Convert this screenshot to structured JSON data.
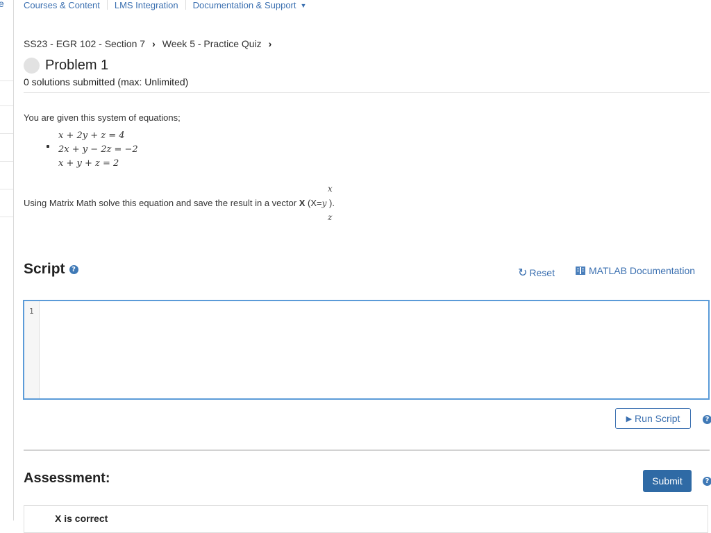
{
  "left_rail": {
    "partial_text": "e"
  },
  "topnav": {
    "items": [
      "Courses & Content",
      "LMS Integration",
      "Documentation & Support"
    ],
    "dropdown_icon": "caret-down-icon"
  },
  "breadcrumb": {
    "items": [
      "SS23 - EGR 102 - Section 7",
      "Week 5 - Practice Quiz"
    ],
    "separator_icon": "chevron-right-icon"
  },
  "problem": {
    "title": "Problem 1",
    "solutions_text": "0 solutions submitted (max: Unlimited)",
    "status_icon": "status-circle-icon"
  },
  "content": {
    "intro": "You are given this system of equations;",
    "equations": [
      "x + 2y + z = 4",
      "2x + y − 2z = −2",
      "x + y + z = 2"
    ],
    "instruction_prefix": "Using Matrix Math solve this equation and save the result in a vector ",
    "instruction_var": "X",
    "instruction_open": " (X=",
    "instruction_close": " ).",
    "vector": [
      "x",
      "y",
      "z"
    ]
  },
  "script": {
    "title": "Script",
    "reset_label": "Reset",
    "doc_label": "MATLAB Documentation",
    "line_numbers": [
      "1"
    ],
    "code": "",
    "run_label": "Run Script"
  },
  "assessment": {
    "title": "Assessment:",
    "submit_label": "Submit",
    "items": [
      "X is correct"
    ]
  },
  "colors": {
    "link": "#3a6fb0",
    "accent": "#2f6aa5",
    "editor_border": "#5b9bd8"
  }
}
